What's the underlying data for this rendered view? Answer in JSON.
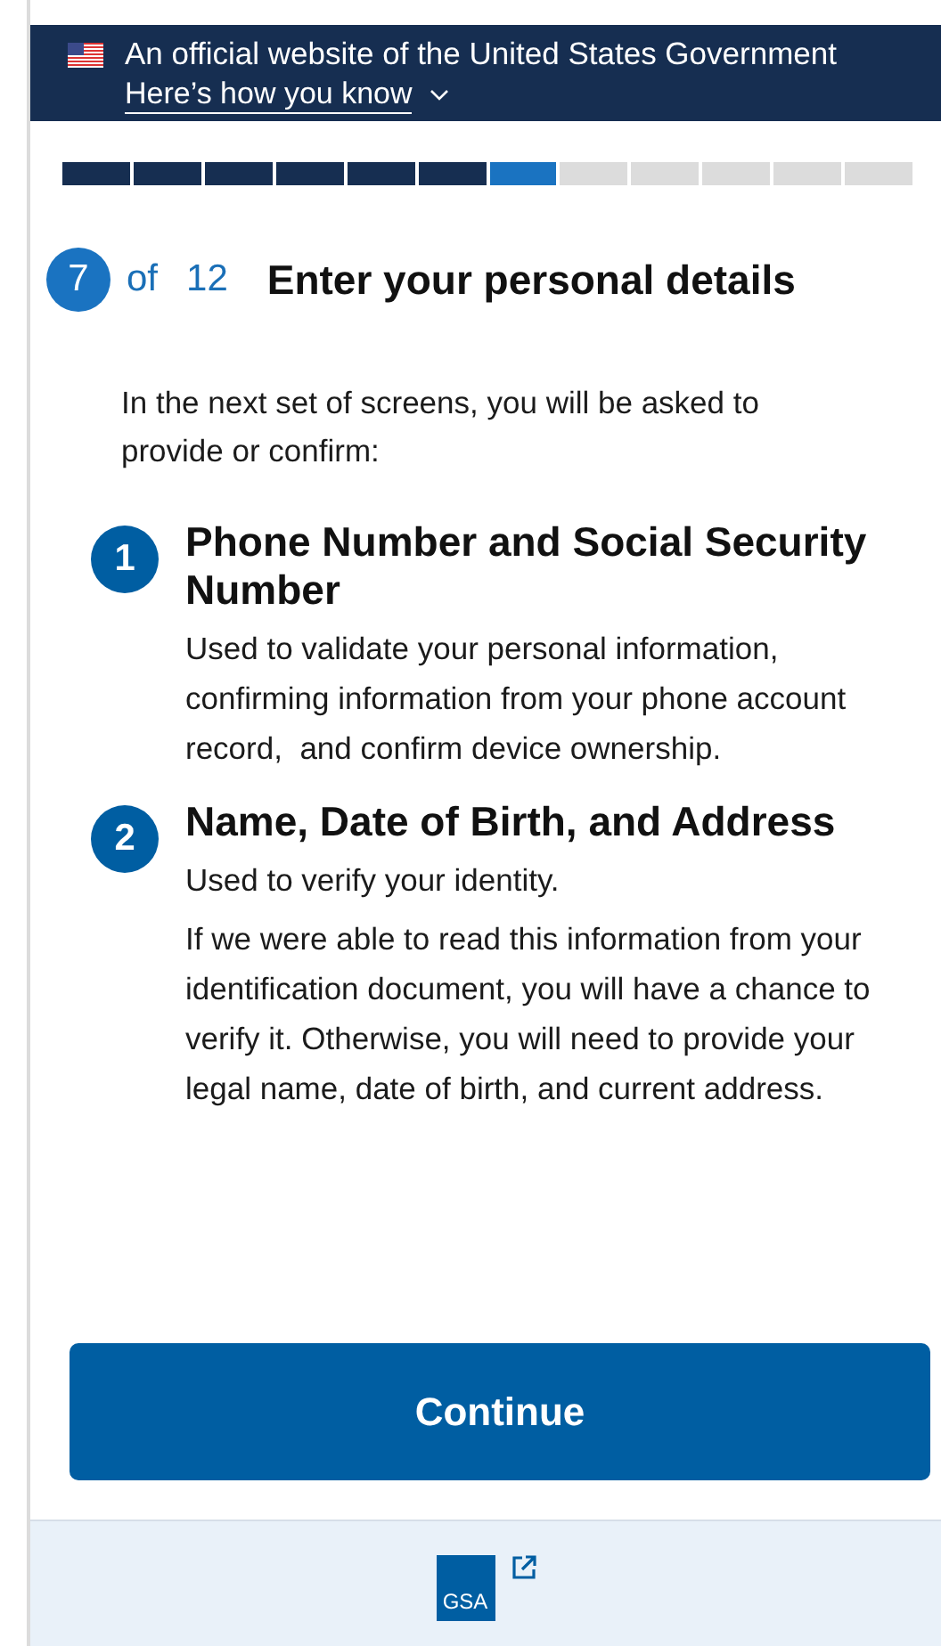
{
  "banner": {
    "text": "An official website of the United States Government",
    "link": "Here’s how you know",
    "expanded": false
  },
  "progress": {
    "segments": [
      {
        "kind": "done"
      },
      {
        "kind": "done"
      },
      {
        "kind": "done"
      },
      {
        "kind": "done"
      },
      {
        "kind": "done"
      },
      {
        "kind": "done"
      },
      {
        "kind": "current"
      },
      {
        "kind": "todo"
      },
      {
        "kind": "todo"
      },
      {
        "kind": "todo"
      },
      {
        "kind": "todo"
      },
      {
        "kind": "todo"
      }
    ]
  },
  "step": {
    "current": "7",
    "of": "of",
    "total": "12",
    "title": "Enter your personal details"
  },
  "intro": "In the next set of screens, you will be asked to provide or confirm:",
  "items": [
    {
      "number": "1",
      "title": "Phone Number and Social Security Number",
      "paragraphs": [
        "Used to validate your personal information, confirming information from your phone account record,  and confirm device ownership."
      ]
    },
    {
      "number": "2",
      "title": "Name, Date of Birth, and Address",
      "paragraphs": [
        "Used to verify your identity.",
        "If we were able to read this information from your identification document, you will have a chance to verify it. Otherwise, you will need to provide your legal name, date of birth, and current address."
      ]
    }
  ],
  "button": "Continue",
  "footer": {
    "logo": "GSA"
  }
}
